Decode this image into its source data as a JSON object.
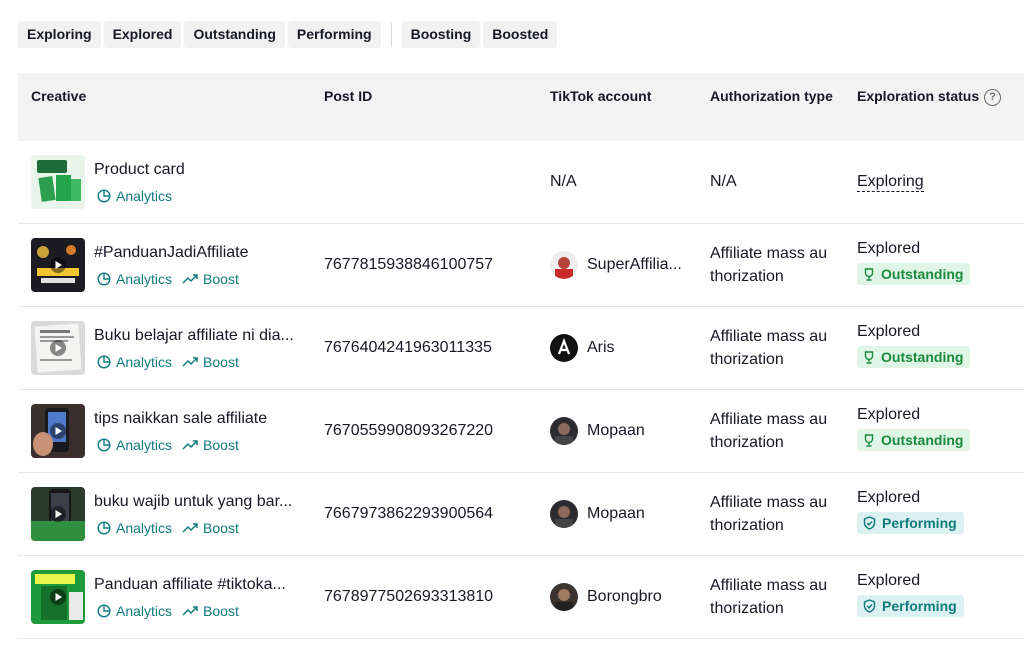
{
  "filters": [
    "Exploring",
    "Explored",
    "Outstanding",
    "Performing"
  ],
  "filters2": [
    "Boosting",
    "Boosted"
  ],
  "columns": {
    "creative": "Creative",
    "post_id": "Post ID",
    "account": "TikTok account",
    "auth": "Authorization type",
    "status": "Exploration status"
  },
  "actions": {
    "analytics": "Analytics",
    "boost": "Boost"
  },
  "rows": [
    {
      "title": "Product card",
      "post_id": "N/A",
      "account": "",
      "auth": "N/A",
      "status": "Exploring",
      "badge": ""
    },
    {
      "title": "#PanduanJadiAffiliate",
      "post_id": "7677815938846100757",
      "account": "SuperAffilia...",
      "auth": "Affiliate mass au thorization",
      "status": "Explored",
      "badge": "Outstanding"
    },
    {
      "title": "Buku belajar affiliate ni dia...",
      "post_id": "7676404241963011335",
      "account": "Aris",
      "auth": "Affiliate mass au thorization",
      "status": "Explored",
      "badge": "Outstanding"
    },
    {
      "title": "tips naikkan sale affiliate",
      "post_id": "7670559908093267220",
      "account": "Mopaan",
      "auth": "Affiliate mass au thorization",
      "status": "Explored",
      "badge": "Outstanding"
    },
    {
      "title": "buku wajib untuk yang bar...",
      "post_id": "7667973862293900564",
      "account": "Mopaan",
      "auth": "Affiliate mass au thorization",
      "status": "Explored",
      "badge": "Performing"
    },
    {
      "title": "Panduan affiliate #tiktoka...",
      "post_id": "7678977502693313810",
      "account": "Borongbro",
      "auth": "Affiliate mass au thorization",
      "status": "Explored",
      "badge": "Performing"
    }
  ],
  "colors": {
    "accent": "#0f7b7d",
    "outstanding_bg": "#dff5e5",
    "outstanding_fg": "#1a8a3d",
    "performing_bg": "#dcf1f1",
    "header_bg": "#f3f3f4"
  }
}
